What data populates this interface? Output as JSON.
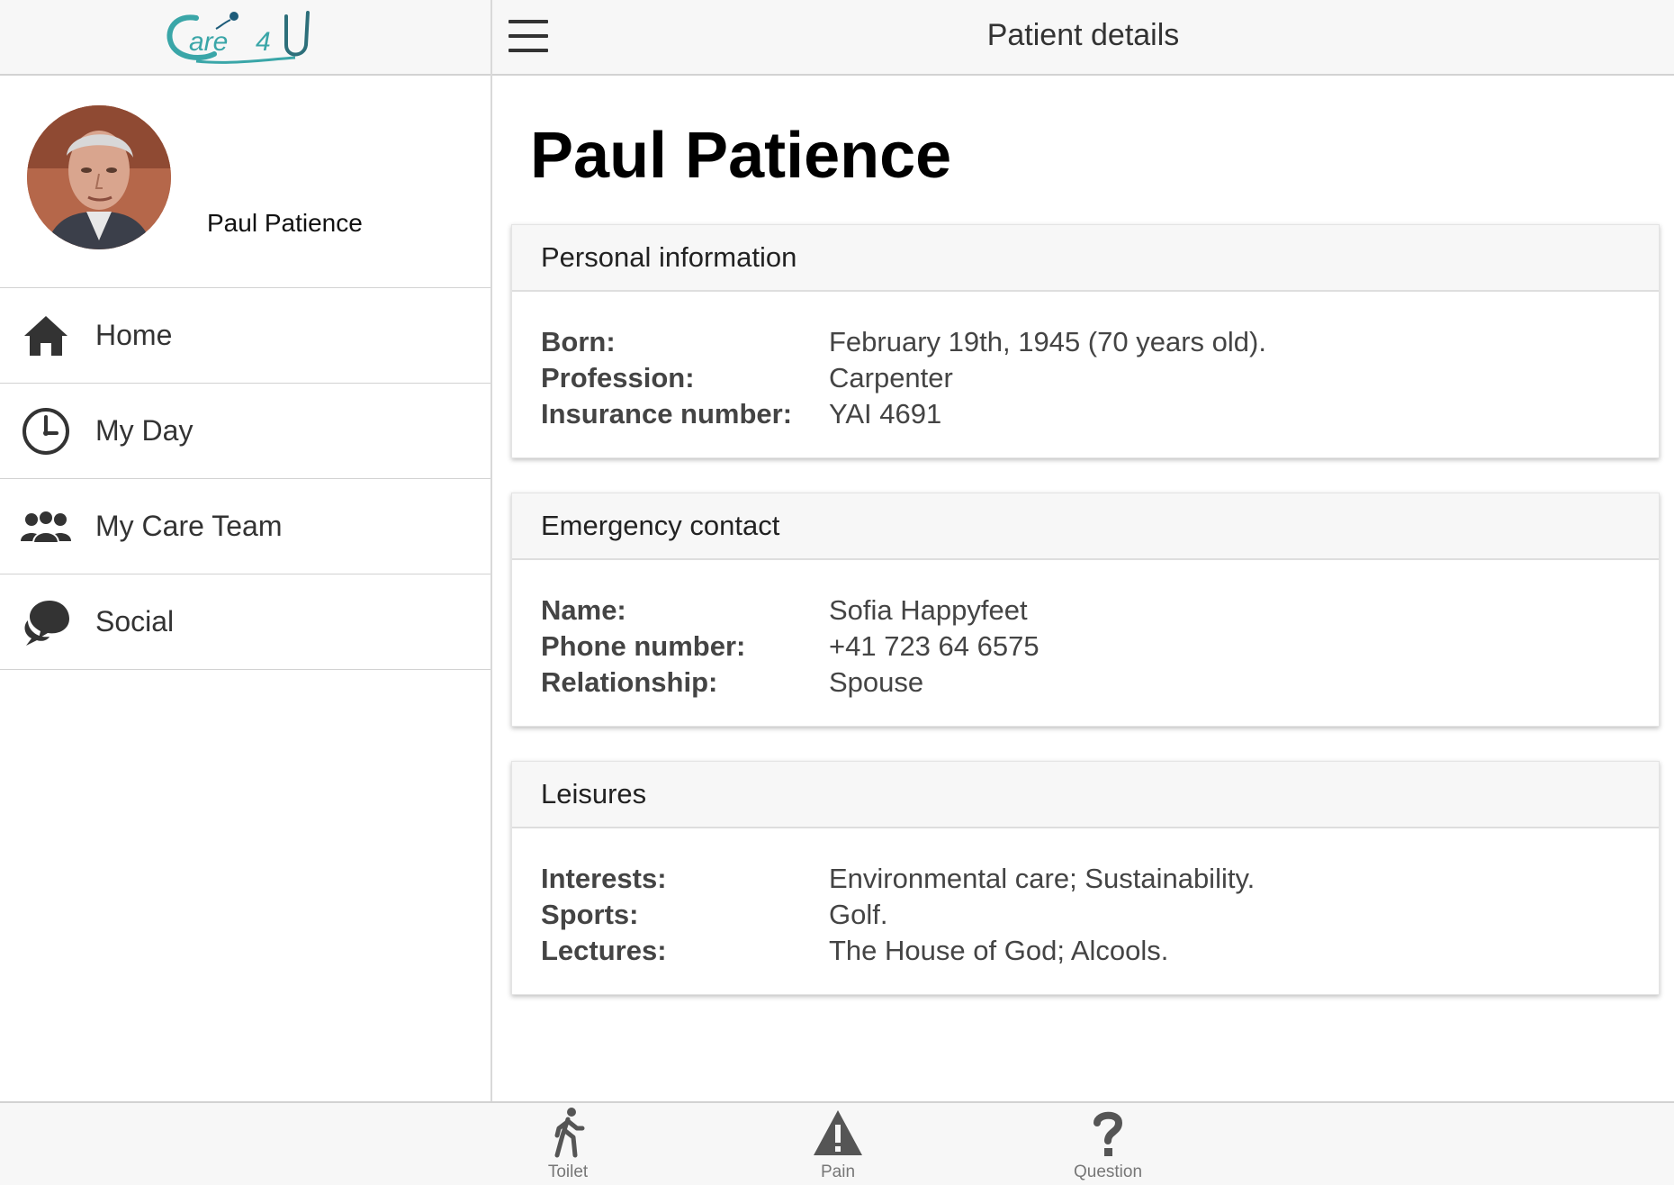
{
  "app": {
    "logo_text": "Care4U",
    "brand_color": "#3aa6a8"
  },
  "topbar": {
    "title": "Patient details",
    "menu_icon": "hamburger-icon"
  },
  "sidebar": {
    "profile_name": "Paul Patience",
    "items": [
      {
        "label": "Home",
        "icon": "home-icon"
      },
      {
        "label": "My Day",
        "icon": "clock-icon"
      },
      {
        "label": "My Care Team",
        "icon": "team-icon"
      },
      {
        "label": "Social",
        "icon": "chat-icon"
      }
    ]
  },
  "main": {
    "title": "Paul Patience",
    "sections": [
      {
        "title": "Personal information",
        "rows": [
          {
            "label": "Born:",
            "value": "February 19th, 1945 (70 years old)."
          },
          {
            "label": "Profession:",
            "value": "Carpenter"
          },
          {
            "label": "Insurance number:",
            "value": "YAI 4691"
          }
        ]
      },
      {
        "title": "Emergency contact",
        "rows": [
          {
            "label": "Name:",
            "value": "Sofia Happyfeet"
          },
          {
            "label": "Phone number:",
            "value": "+41 723 64 6575"
          },
          {
            "label": "Relationship:",
            "value": "Spouse"
          }
        ]
      },
      {
        "title": "Leisures",
        "rows": [
          {
            "label": "Interests:",
            "value": "Environmental care; Sustainability."
          },
          {
            "label": "Sports:",
            "value": "Golf."
          },
          {
            "label": "Lectures:",
            "value": "The House of God; Alcools."
          }
        ]
      }
    ]
  },
  "tabbar": {
    "items": [
      {
        "label": "Toilet",
        "icon": "walking-person-icon"
      },
      {
        "label": "Pain",
        "icon": "warning-icon"
      },
      {
        "label": "Question",
        "icon": "question-mark-icon"
      }
    ]
  }
}
